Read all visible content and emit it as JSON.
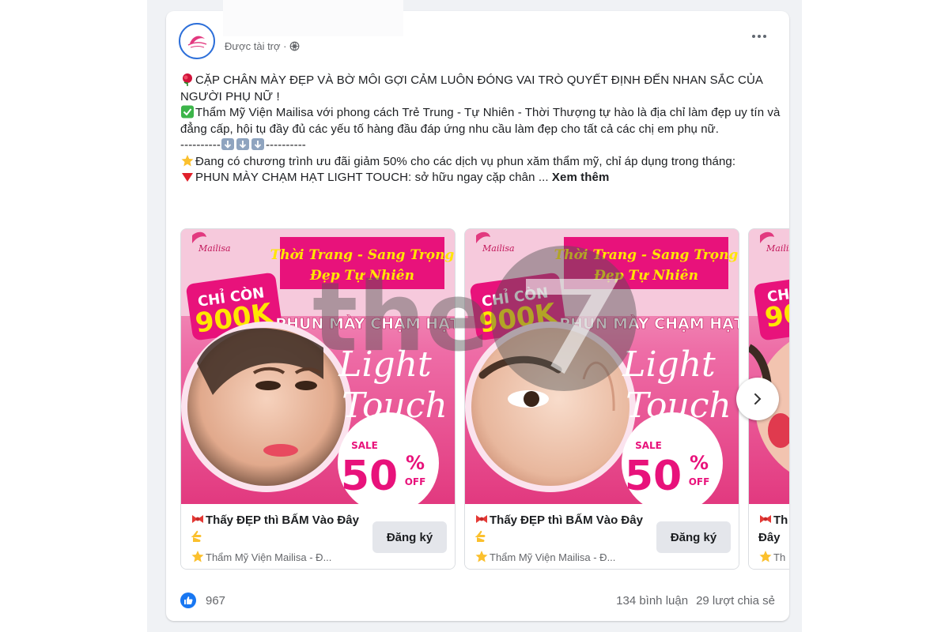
{
  "post": {
    "sponsored_label": "Được tài trợ ·",
    "more_label": "•••",
    "text_lines": [
      "CẶP CHÂN MÀY ĐẸP VÀ BỜ MÔI GỢI CẢM LUÔN ĐÓNG VAI TRÒ QUYẾT ĐỊNH ĐẾN NHAN SẮC CỦA NGƯỜI PHỤ NỮ !",
      "Thẩm Mỹ Viện Mailisa với phong cách Trẻ Trung - Tự Nhiên - Thời Thượng tự hào là địa chỉ làm đẹp uy tín và đẳng cấp, hội tụ đầy đủ các yếu tố hàng đầu đáp ứng nhu cầu làm đẹp cho tất cả các chị em phụ nữ.",
      "Đang có chương trình ưu đãi giảm 50% cho các dịch vụ phun xăm thẩm mỹ, chỉ áp dụng trong tháng:",
      "PHUN MÀY CHẠM HẠT LIGHT TOUCH: sở hữu ngay cặp chân ..."
    ],
    "divider_left": "----------",
    "divider_right": "----------",
    "see_more": "Xem thêm",
    "icons": [
      "rose-icon",
      "check-icon",
      "down-arrow-icon",
      "star-icon",
      "red-triangle-icon"
    ]
  },
  "carousel": {
    "cards": [
      {
        "banner_line1": "Thời Trang - Sang Trọng",
        "banner_line2": "Đẹp Tự Nhiên",
        "price_label": "CHỈ CÒN",
        "price": "900K",
        "service": "PHUN MÀY CHẠM HẠT",
        "script_line1": "Light",
        "script_line2": "Touch",
        "sale_label": "SALE",
        "sale_value": "50",
        "sale_pct": "%",
        "sale_off": "OFF",
        "logo_text": "Mailisa",
        "title": "Thấy ĐẸP thì BẤM Vào Đây",
        "subtitle": "Thẩm Mỹ Viện Mailisa - Đ...",
        "button": "Đăng ký"
      },
      {
        "banner_line1": "Thời Trang - Sang Trọng",
        "banner_line2": "Đẹp Tự Nhiên",
        "price_label": "CHỈ CÒN",
        "price": "900K",
        "service": "PHUN MÀY CHẠM HẠT",
        "script_line1": "Light",
        "script_line2": "Touch",
        "sale_label": "SALE",
        "sale_value": "50",
        "sale_pct": "%",
        "sale_off": "OFF",
        "logo_text": "Mailisa",
        "title": "Thấy ĐẸP thì BẤM Vào Đây",
        "subtitle": "Thẩm Mỹ Viện Mailisa - Đ...",
        "button": "Đăng ký"
      },
      {
        "price_label": "CH",
        "price": "90",
        "logo_text": "Mailisa",
        "title": "Th",
        "title2": "Đây",
        "subtitle": "Th"
      }
    ]
  },
  "stats": {
    "likes": "967",
    "comments": "134 bình luận",
    "shares": "29 lượt chia sẻ"
  },
  "colors": {
    "pink_dark": "#e2397f",
    "pink_banner": "#e8127b",
    "yellow_text": "#ffe600",
    "fb_blue": "#1877f2"
  },
  "watermark_text": "the"
}
